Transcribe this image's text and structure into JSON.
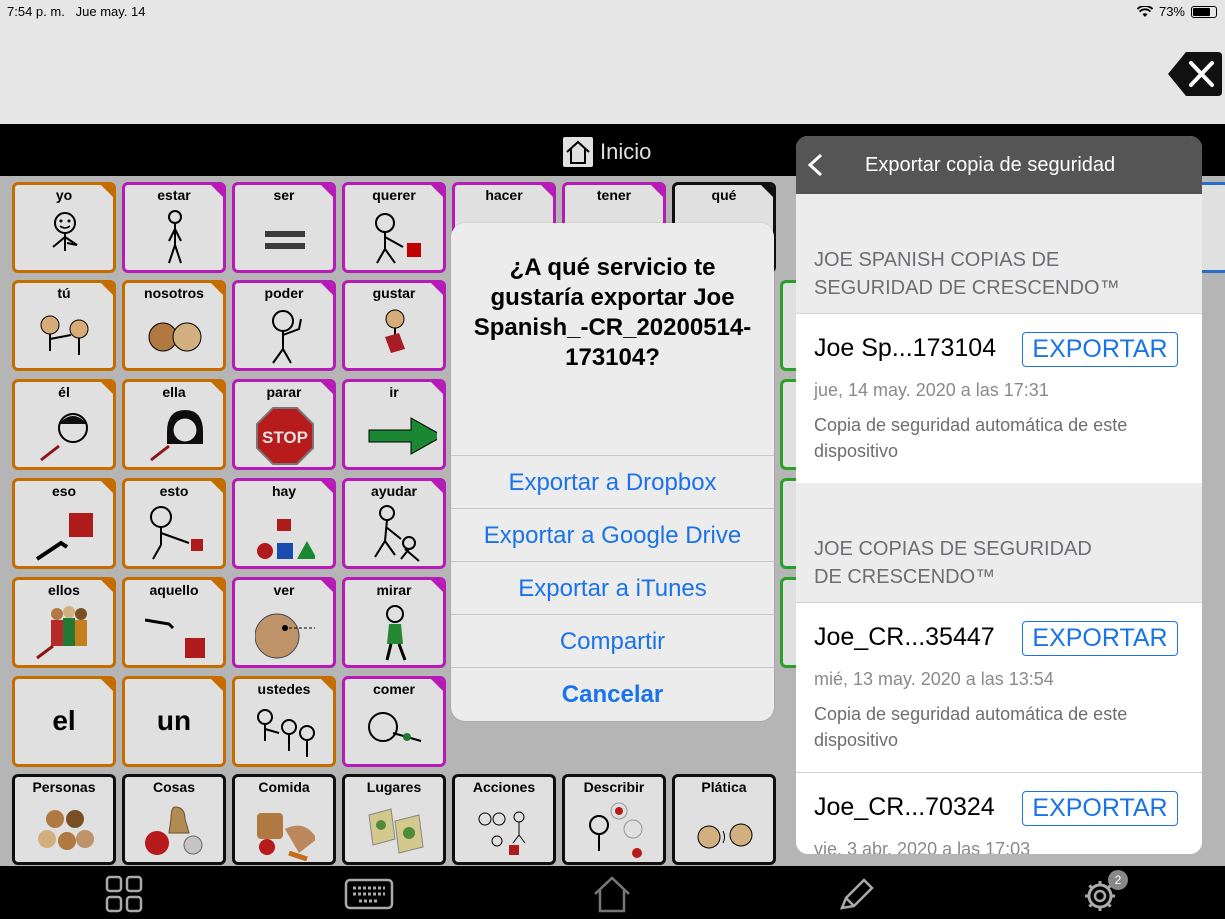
{
  "status_bar": {
    "time": "7:54 p. m.",
    "date": "Jue may. 14",
    "battery": "73%"
  },
  "title_bar": {
    "title": "Inicio"
  },
  "grid": {
    "cells": [
      {
        "label": "yo",
        "color": "orange"
      },
      {
        "label": "estar",
        "color": "pink"
      },
      {
        "label": "ser",
        "color": "pink"
      },
      {
        "label": "querer",
        "color": "pink"
      },
      {
        "label": "hacer",
        "color": "pink"
      },
      {
        "label": "tener",
        "color": "pink"
      },
      {
        "label": "qué",
        "color": "black"
      },
      {
        "label": "tú",
        "color": "orange"
      },
      {
        "label": "nosotros",
        "color": "orange"
      },
      {
        "label": "poder",
        "color": "pink"
      },
      {
        "label": "gustar",
        "color": "pink"
      },
      {
        "label": "él",
        "color": "orange"
      },
      {
        "label": "ella",
        "color": "orange"
      },
      {
        "label": "parar",
        "color": "pink"
      },
      {
        "label": "ir",
        "color": "pink"
      },
      {
        "label": "eso",
        "color": "orange"
      },
      {
        "label": "esto",
        "color": "orange"
      },
      {
        "label": "hay",
        "color": "pink"
      },
      {
        "label": "ayudar",
        "color": "pink"
      },
      {
        "label": "ellos",
        "color": "orange"
      },
      {
        "label": "aquello",
        "color": "orange"
      },
      {
        "label": "ver",
        "color": "pink"
      },
      {
        "label": "mirar",
        "color": "pink"
      },
      {
        "label": "el",
        "color": "orange"
      },
      {
        "label": "un",
        "color": "orange"
      },
      {
        "label": "ustedes",
        "color": "orange"
      },
      {
        "label": "comer",
        "color": "pink"
      },
      {
        "label": "Personas",
        "color": "black"
      },
      {
        "label": "Cosas",
        "color": "black"
      },
      {
        "label": "Comida",
        "color": "black"
      },
      {
        "label": "Lugares",
        "color": "black"
      },
      {
        "label": "Acciones",
        "color": "black"
      },
      {
        "label": "Describir",
        "color": "black"
      },
      {
        "label": "Plática",
        "color": "black"
      }
    ],
    "stop_sign_text": "STOP"
  },
  "alert": {
    "question": "¿A qué servicio te gustaría exportar Joe Spanish_-CR_20200514-173104?",
    "options": [
      "Exportar a Dropbox",
      "Exportar a Google Drive",
      "Exportar a iTunes",
      "Compartir",
      "Cancelar"
    ]
  },
  "panel": {
    "title": "Exportar copia de seguridad",
    "sections": [
      {
        "header": "JOE SPANISH COPIAS DE SEGURIDAD DE CRESCENDO™",
        "items": [
          {
            "name": "Joe Sp...173104",
            "action": "EXPORTAR",
            "date": "jue, 14 may. 2020 a las 17:31",
            "description": "Copia de seguridad automática de este dispositivo"
          }
        ]
      },
      {
        "header": "JOE COPIAS DE SEGURIDAD DE CRESCENDO™",
        "items": [
          {
            "name": "Joe_CR...35447",
            "action": "EXPORTAR",
            "date": "mié, 13 may. 2020 a las 13:54",
            "description": "Copia de seguridad automática de este dispositivo"
          },
          {
            "name": "Joe_CR...70324",
            "action": "EXPORTAR",
            "date": "vie, 3 abr. 2020 a las 17:03",
            "description": ""
          }
        ]
      }
    ]
  },
  "toolbar": {
    "settings_badge": "2"
  },
  "icons": [
    "close-icon",
    "home-icon",
    "grid-icon",
    "keyboard-icon",
    "pencil-icon",
    "gear-icon",
    "wifi-icon",
    "battery-icon",
    "back-chevron-icon"
  ]
}
